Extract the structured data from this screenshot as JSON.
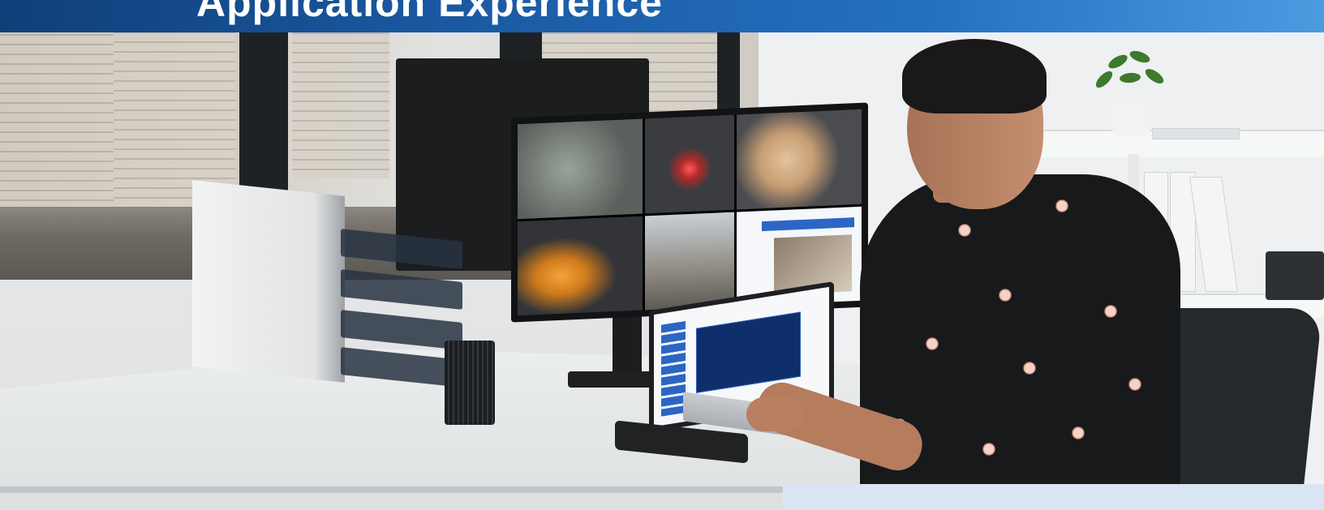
{
  "banner": {
    "title": "Application Experience",
    "gradient_start": "#0f3f79",
    "gradient_end": "#4a9be0"
  },
  "photo": {
    "colors": {
      "shirt": "#17191b",
      "slide_blue": "#0f2f6b",
      "accent_orange": "#d07a1c"
    }
  }
}
